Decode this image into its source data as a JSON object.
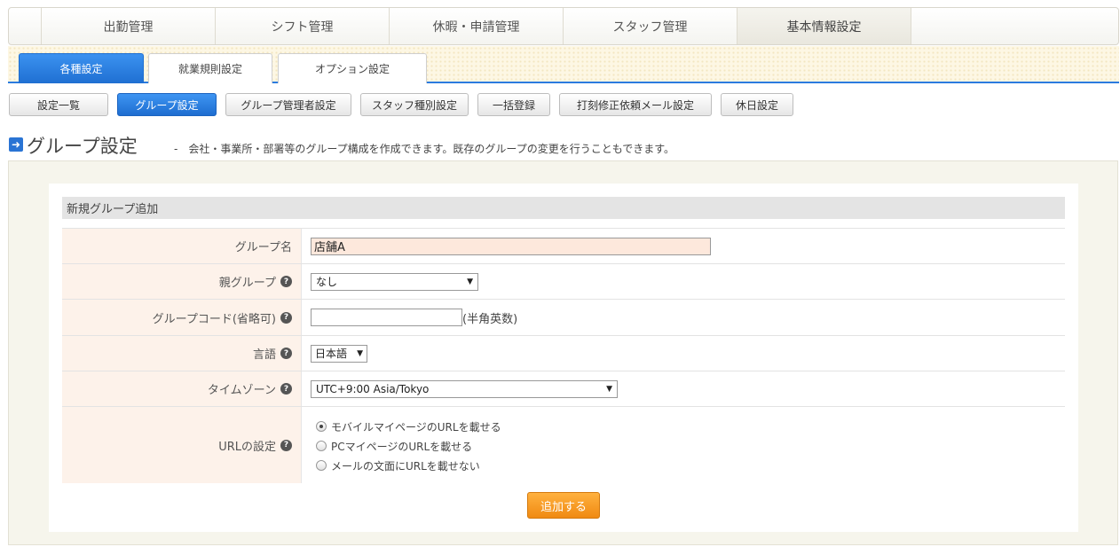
{
  "main_tabs": [
    {
      "label": "出勤管理"
    },
    {
      "label": "シフト管理"
    },
    {
      "label": "休暇・申請管理"
    },
    {
      "label": "スタッフ管理"
    },
    {
      "label": "基本情報設定"
    }
  ],
  "sub_tabs": [
    {
      "label": "各種設定"
    },
    {
      "label": "就業規則設定"
    },
    {
      "label": "オプション設定"
    }
  ],
  "settings_buttons": [
    {
      "label": "設定一覧"
    },
    {
      "label": "グループ設定"
    },
    {
      "label": "グループ管理者設定"
    },
    {
      "label": "スタッフ種別設定"
    },
    {
      "label": "一括登録"
    },
    {
      "label": "打刻修正依頼メール設定"
    },
    {
      "label": "休日設定"
    }
  ],
  "page": {
    "title": "グループ設定",
    "description": "-　会社・事業所・部署等のグループ構成を作成できます。既存のグループの変更を行うこともできます。"
  },
  "form": {
    "section_title": "新規グループ追加",
    "group_name": {
      "label": "グループ名",
      "value": "店舗A"
    },
    "parent_group": {
      "label": "親グループ",
      "value": "なし"
    },
    "group_code": {
      "label": "グループコード(省略可)",
      "value": "",
      "hint": "(半角英数)"
    },
    "language": {
      "label": "言語",
      "value": "日本語"
    },
    "timezone": {
      "label": "タイムゾーン",
      "value": "UTC+9:00 Asia/Tokyo"
    },
    "url_setting": {
      "label": "URLの設定",
      "options": [
        {
          "label": "モバイルマイページのURLを載せる",
          "checked": true
        },
        {
          "label": "PCマイページのURLを載せる",
          "checked": false
        },
        {
          "label": "メールの文面にURLを載せない",
          "checked": false
        }
      ]
    },
    "help_glyph": "?",
    "submit_label": "追加する"
  },
  "icons": {
    "title_arrow": "➜",
    "caret": "▼"
  },
  "colors": {
    "accent_blue": "#2b7bde",
    "submit_orange": "#f5a02a",
    "label_bg": "#fdf2ea"
  }
}
